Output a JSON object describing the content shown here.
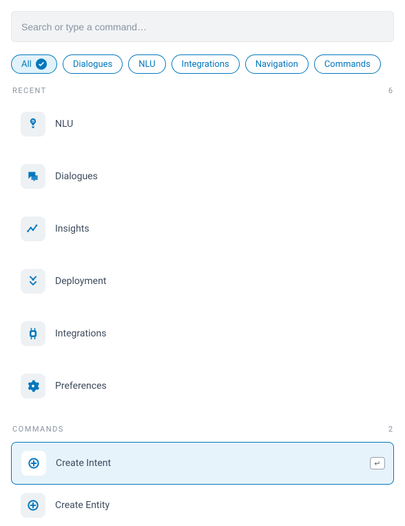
{
  "search": {
    "placeholder": "Search or type a command…",
    "value": ""
  },
  "filters": {
    "items": [
      {
        "label": "All",
        "active": true
      },
      {
        "label": "Dialogues",
        "active": false
      },
      {
        "label": "NLU",
        "active": false
      },
      {
        "label": "Integrations",
        "active": false
      },
      {
        "label": "Navigation",
        "active": false
      },
      {
        "label": "Commands",
        "active": false
      }
    ]
  },
  "sections": {
    "recent": {
      "title": "Recent",
      "count": "6",
      "items": [
        {
          "label": "NLU",
          "icon": "nlu-icon"
        },
        {
          "label": "Dialogues",
          "icon": "dialogues-icon"
        },
        {
          "label": "Insights",
          "icon": "insights-icon"
        },
        {
          "label": "Deployment",
          "icon": "deployment-icon"
        },
        {
          "label": "Integrations",
          "icon": "integrations-icon"
        },
        {
          "label": "Preferences",
          "icon": "preferences-icon"
        }
      ]
    },
    "commands": {
      "title": "Commands",
      "count": "2",
      "items": [
        {
          "label": "Create Intent",
          "icon": "add-circle-icon",
          "selected": true
        },
        {
          "label": "Create Entity",
          "icon": "add-circle-icon",
          "selected": false
        }
      ]
    }
  },
  "colors": {
    "accent": "#0277bd"
  }
}
